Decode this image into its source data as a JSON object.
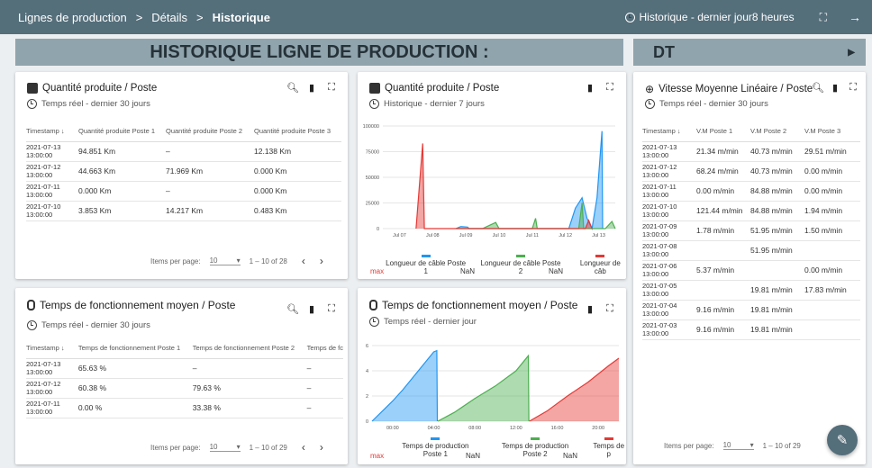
{
  "topbar": {
    "crumb1": "Lignes de production",
    "sep1": ">",
    "crumb2": "Détails",
    "sep2": ">",
    "crumb3": "Historique",
    "history_label": "Historique - dernier jour8 heures"
  },
  "section": {
    "title": "HISTORIQUE LIGNE DE PRODUCTION :",
    "dt": "DT"
  },
  "card1": {
    "title": "Quantité produite / Poste",
    "subtitle": "Temps réel - dernier 30 jours",
    "headers": [
      "Timestamp",
      "Quantité produite Poste 1",
      "Quantité produite Poste 2",
      "Quantité produite Poste 3"
    ],
    "rows": [
      {
        "ts1": "2021-07-13",
        "ts2": "13:00:00",
        "c1": "94.851 Km",
        "c2": "–",
        "c3": "12.138 Km"
      },
      {
        "ts1": "2021-07-12",
        "ts2": "13:00:00",
        "c1": "44.663 Km",
        "c2": "71.969 Km",
        "c3": "0.000 Km"
      },
      {
        "ts1": "2021-07-11",
        "ts2": "13:00:00",
        "c1": "0.000 Km",
        "c2": "–",
        "c3": "0.000 Km"
      },
      {
        "ts1": "2021-07-10",
        "ts2": "13:00:00",
        "c1": "3.853 Km",
        "c2": "14.217 Km",
        "c3": "0.483 Km"
      }
    ],
    "items_label": "Items per page:",
    "items_value": "10",
    "range": "1 – 10 of 28"
  },
  "card2": {
    "title": "Quantité produite / Poste",
    "subtitle": "Historique - dernier 7 jours",
    "legend": [
      "Longueur de câble Poste 1",
      "Longueur de câble Poste 2",
      "Longueur de câb"
    ],
    "max_label": "max",
    "max_values": [
      "NaN",
      "NaN"
    ]
  },
  "card3": {
    "title": "Temps de fonctionnement moyen / Poste",
    "subtitle": "Temps réel - dernier 30 jours",
    "headers": [
      "Timestamp",
      "Temps de fonctionnement Poste 1",
      "Temps de fonctionnement Poste 2",
      "Temps de fc"
    ],
    "rows": [
      {
        "ts1": "2021-07-13",
        "ts2": "13:00:00",
        "c1": "65.63 %",
        "c2": "–",
        "c3": "–"
      },
      {
        "ts1": "2021-07-12",
        "ts2": "13:00:00",
        "c1": "60.38 %",
        "c2": "79.63 %",
        "c3": "–"
      },
      {
        "ts1": "2021-07-11",
        "ts2": "13:00:00",
        "c1": "0.00 %",
        "c2": "33.38 %",
        "c3": "–"
      }
    ],
    "items_label": "Items per page:",
    "items_value": "10",
    "range": "1 – 10 of 29"
  },
  "card4": {
    "title": "Temps de fonctionnement moyen / Poste",
    "subtitle": "Temps réel - dernier jour",
    "legend": [
      "Temps de production Poste 1",
      "Temps de production Poste 2",
      "Temps de p"
    ],
    "max_label": "max",
    "max_values": [
      "NaN",
      "NaN"
    ]
  },
  "card5": {
    "title": "Vitesse Moyenne Linéaire / Poste",
    "subtitle": "Temps réel - dernier 30 jours",
    "headers": [
      "Timestamp",
      "V.M Poste 1",
      "V.M Poste 2",
      "V.M Poste 3"
    ],
    "rows": [
      {
        "ts1": "2021-07-13",
        "ts2": "13:00:00",
        "c1": "21.34 m/min",
        "c2": "40.73 m/min",
        "c3": "29.51 m/min"
      },
      {
        "ts1": "2021-07-12",
        "ts2": "13:00:00",
        "c1": "68.24 m/min",
        "c2": "40.73 m/min",
        "c3": "0.00 m/min"
      },
      {
        "ts1": "2021-07-11",
        "ts2": "13:00:00",
        "c1": "0.00 m/min",
        "c2": "84.88 m/min",
        "c3": "0.00 m/min"
      },
      {
        "ts1": "2021-07-10",
        "ts2": "13:00:00",
        "c1": "121.44 m/min",
        "c2": "84.88 m/min",
        "c3": "1.94 m/min"
      },
      {
        "ts1": "2021-07-09",
        "ts2": "13:00:00",
        "c1": "1.78 m/min",
        "c2": "51.95 m/min",
        "c3": "1.50 m/min"
      },
      {
        "ts1": "2021-07-08",
        "ts2": "13:00:00",
        "c1": "",
        "c2": "51.95 m/min",
        "c3": ""
      },
      {
        "ts1": "2021-07-06",
        "ts2": "13:00:00",
        "c1": "5.37 m/min",
        "c2": "",
        "c3": "0.00 m/min"
      },
      {
        "ts1": "2021-07-05",
        "ts2": "13:00:00",
        "c1": "",
        "c2": "19.81 m/min",
        "c3": "17.83 m/min"
      },
      {
        "ts1": "2021-07-04",
        "ts2": "13:00:00",
        "c1": "9.16 m/min",
        "c2": "19.81 m/min",
        "c3": ""
      },
      {
        "ts1": "2021-07-03",
        "ts2": "13:00:00",
        "c1": "9.16 m/min",
        "c2": "19.81 m/min",
        "c3": ""
      }
    ],
    "items_label": "Items per page:",
    "items_value": "10",
    "range": "1 – 10 of 29"
  },
  "colors": {
    "blue": "#2196f3",
    "green": "#4caf50",
    "red": "#e53935",
    "topbar": "#546e7a"
  },
  "chart_data": [
    {
      "type": "area",
      "y_ticks": [
        "0",
        "25000",
        "50000",
        "75000",
        "100000"
      ],
      "x_ticks": [
        "Jul 07",
        "Jul 08",
        "Jul 09",
        "Jul 10",
        "Jul 11",
        "Jul 12",
        "Jul 13"
      ],
      "ylim": [
        0,
        100000
      ],
      "series": [
        {
          "name": "Longueur de câble Poste 1",
          "points": [
            [
              2.2,
              0
            ],
            [
              2.35,
              2000
            ],
            [
              2.55,
              1500
            ],
            [
              2.6,
              0
            ],
            [
              5.6,
              0
            ],
            [
              5.8,
              20000
            ],
            [
              6.0,
              30000
            ],
            [
              6.15,
              10000
            ],
            [
              6.3,
              0
            ],
            [
              6.45,
              30000
            ],
            [
              6.6,
              95000
            ],
            [
              6.62,
              0
            ]
          ]
        },
        {
          "name": "Longueur de câble Poste 2",
          "points": [
            [
              2.2,
              0
            ],
            [
              3.0,
              0
            ],
            [
              3.2,
              3000
            ],
            [
              3.4,
              6000
            ],
            [
              3.5,
              0
            ],
            [
              4.5,
              0
            ],
            [
              4.6,
              10000
            ],
            [
              4.65,
              0
            ],
            [
              5.9,
              0
            ],
            [
              6.0,
              25000
            ],
            [
              6.05,
              0
            ],
            [
              6.7,
              0
            ],
            [
              6.9,
              7000
            ],
            [
              7.0,
              0
            ]
          ]
        },
        {
          "name": "Longueur de câble Poste 3",
          "points": [
            [
              1.0,
              0
            ],
            [
              1.2,
              83000
            ],
            [
              1.25,
              0
            ],
            [
              6.1,
              0
            ],
            [
              6.2,
              8000
            ],
            [
              6.3,
              0
            ]
          ]
        }
      ]
    },
    {
      "type": "area",
      "y_ticks": [
        "0",
        "2",
        "4",
        "6"
      ],
      "x_ticks": [
        "00:00",
        "04:00",
        "08:00",
        "12:00",
        "16:00",
        "20:00"
      ],
      "ylim": [
        0,
        6
      ],
      "series": [
        {
          "name": "Temps de production Poste 1",
          "points": [
            [
              0,
              0
            ],
            [
              1,
              0.8
            ],
            [
              2,
              1.6
            ],
            [
              3,
              2.5
            ],
            [
              4,
              3.5
            ],
            [
              5,
              4.5
            ],
            [
              6,
              5.5
            ],
            [
              6.3,
              5.6
            ],
            [
              6.35,
              0
            ]
          ]
        },
        {
          "name": "Temps de production Poste 2",
          "points": [
            [
              6.4,
              0
            ],
            [
              8,
              0.7
            ],
            [
              10,
              1.8
            ],
            [
              12,
              2.8
            ],
            [
              14,
              4.0
            ],
            [
              15.2,
              5.2
            ],
            [
              15.25,
              0
            ]
          ]
        },
        {
          "name": "Temps de production Poste 3",
          "points": [
            [
              15.3,
              0
            ],
            [
              17,
              0.8
            ],
            [
              19,
              2.0
            ],
            [
              21,
              3.1
            ],
            [
              23,
              4.4
            ],
            [
              24,
              5.0
            ]
          ]
        }
      ]
    }
  ]
}
